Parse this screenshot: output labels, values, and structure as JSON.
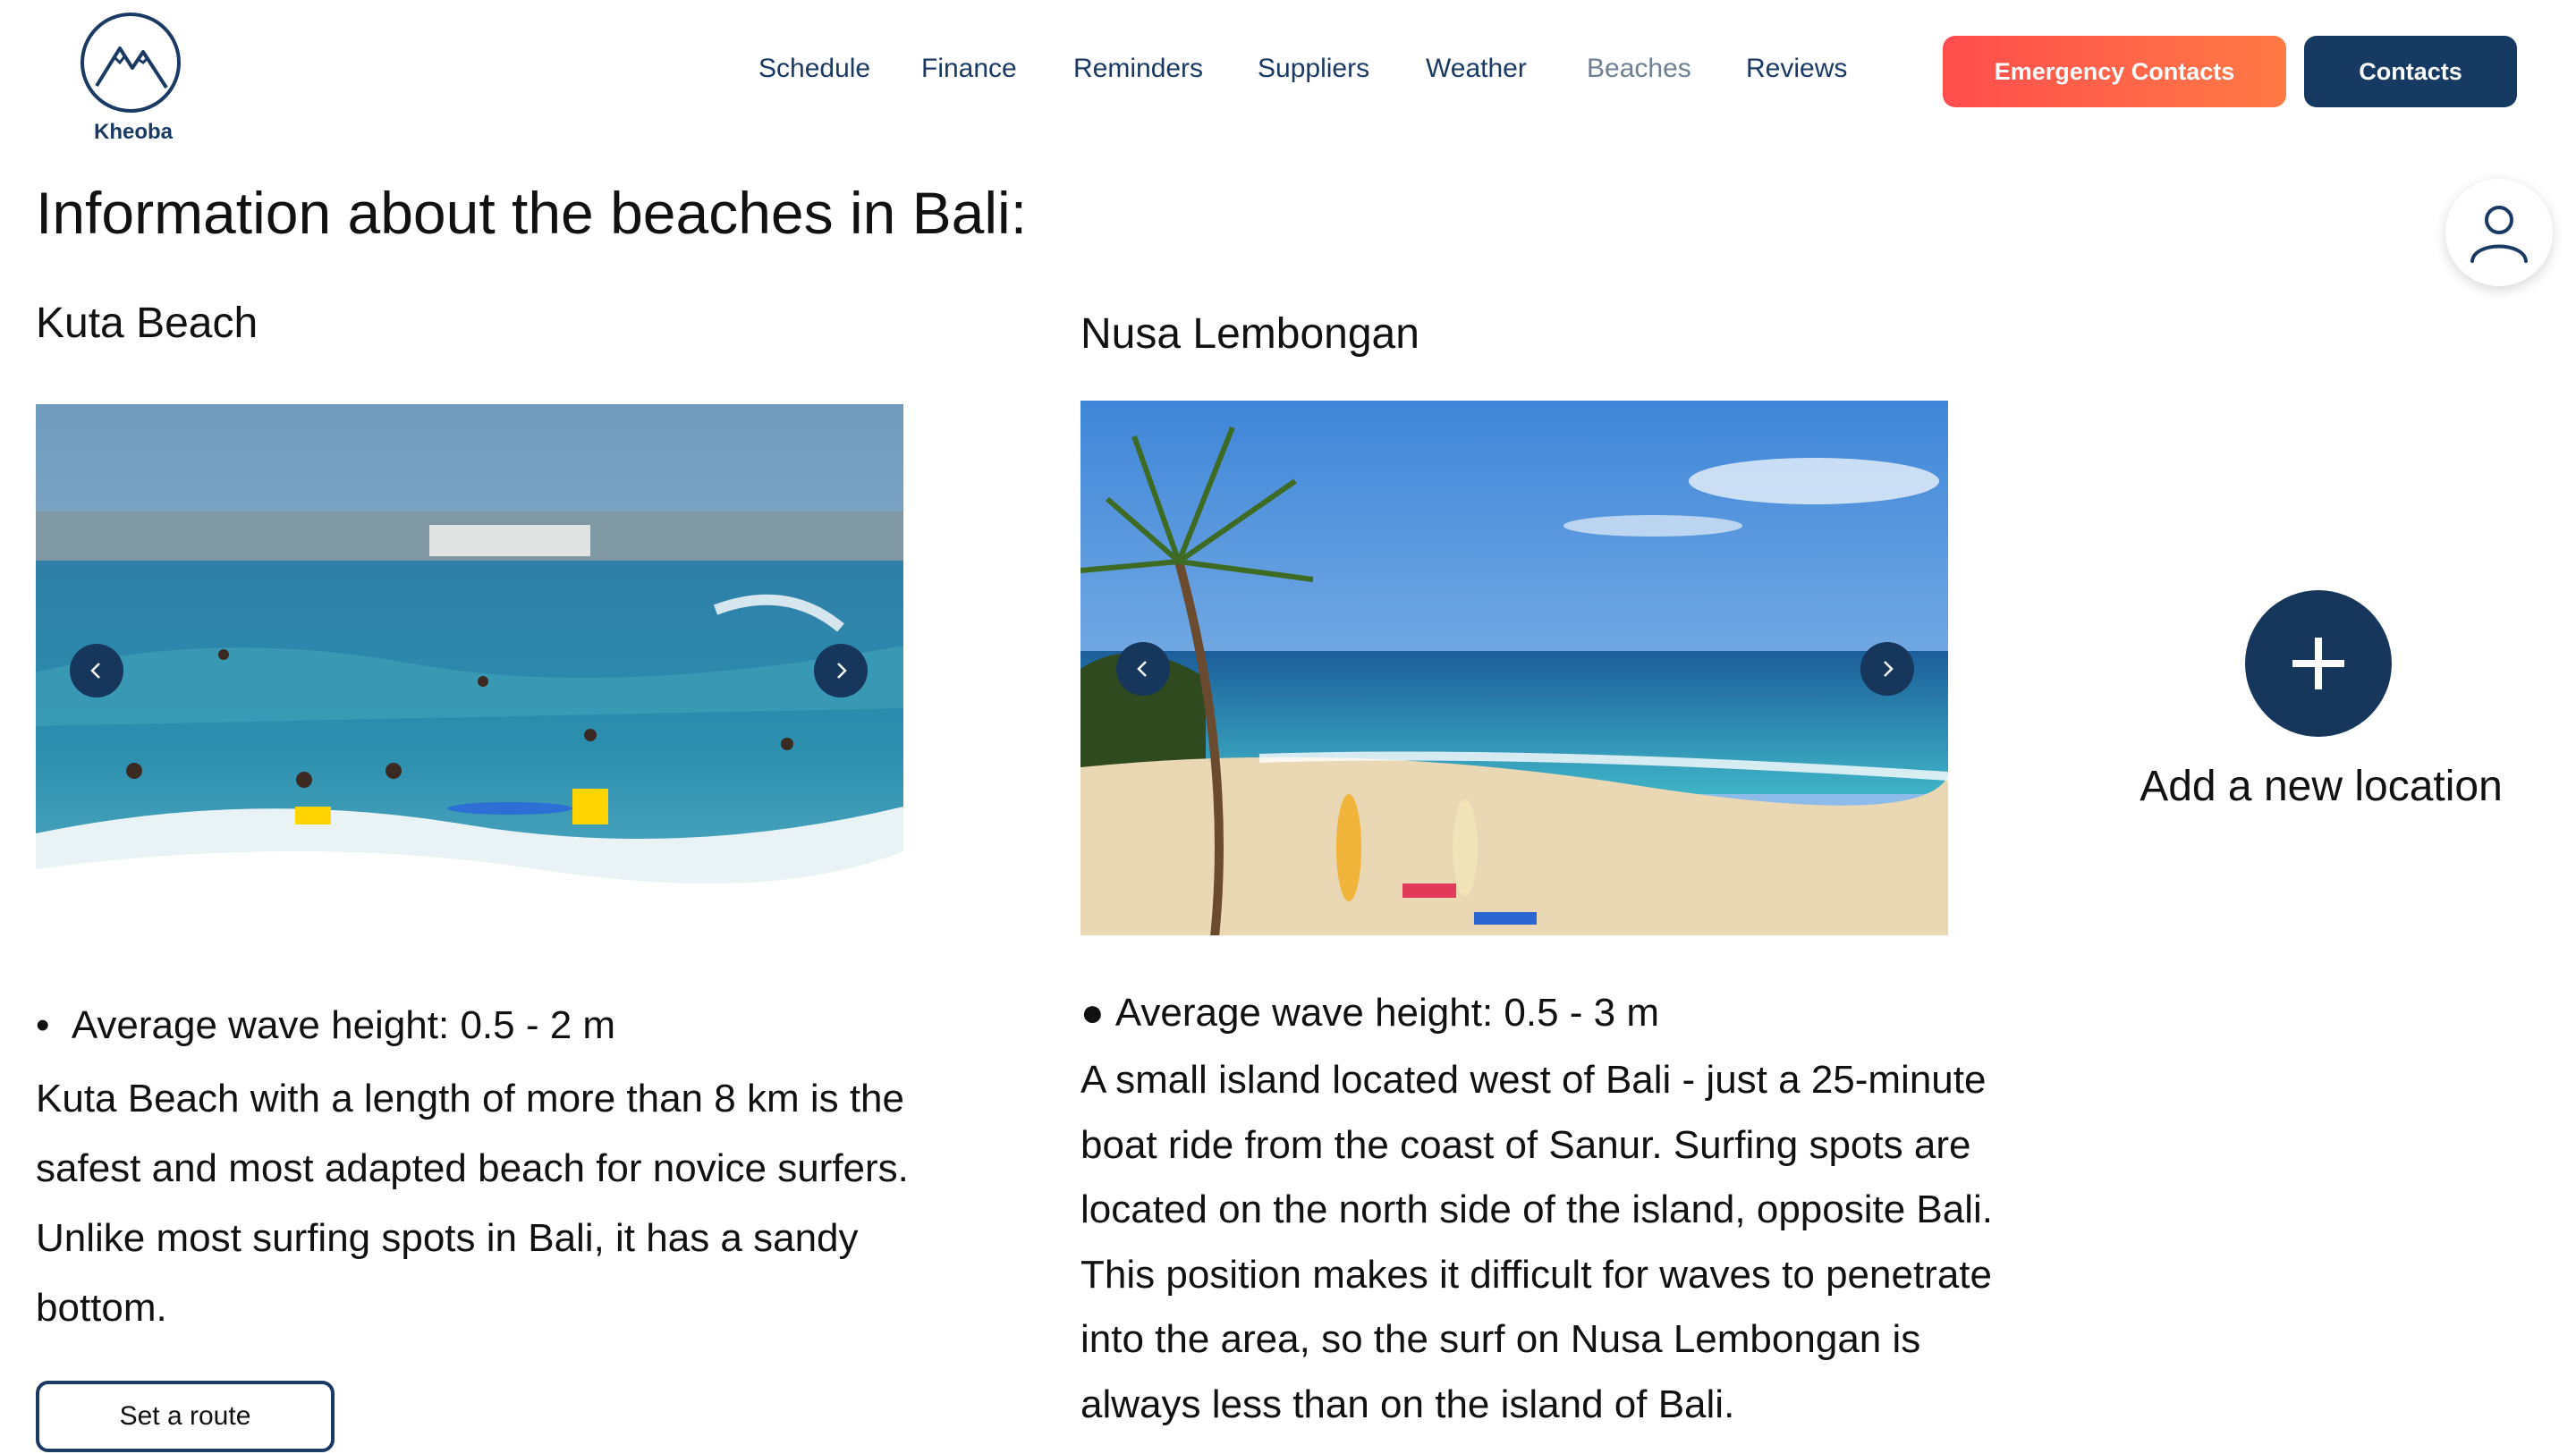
{
  "brand": {
    "name": "Kheoba",
    "color": "#1a3a63"
  },
  "nav": {
    "items": [
      {
        "label": "Schedule"
      },
      {
        "label": "Finance"
      },
      {
        "label": "Reminders"
      },
      {
        "label": "Suppliers"
      },
      {
        "label": "Weather"
      },
      {
        "label": "Beaches",
        "active": true
      },
      {
        "label": "Reviews"
      }
    ]
  },
  "header": {
    "emergency_label": "Emergency Contacts",
    "contacts_label": "Contacts",
    "avatar_icon": "user-icon"
  },
  "page": {
    "title": "Information about the beaches in Bali:"
  },
  "beaches": [
    {
      "name": "Kuta Beach",
      "wave": "Average wave height: 0.5 - 2 m",
      "description": "Kuta Beach with a length of more than 8 km is the safest and most adapted beach for novice surfers. Unlike most surfing spots in Bali, it has a sandy bottom.",
      "button": "Set a route"
    },
    {
      "name": "Nusa Lembongan",
      "wave": "Average wave height: 0.5 - 3 m",
      "description": "A small island located west of Bali - just a 25-minute boat ride from the coast of Sanur. Surfing spots are located on the north side of the island, opposite Bali. This position makes it difficult for waves to penetrate into the area, so the surf on Nusa Lembongan is always less than on the island of Bali."
    }
  ],
  "add_location": {
    "label": "Add a new location",
    "icon": "plus-icon"
  },
  "colors": {
    "primary": "#173a62",
    "emergency_start": "#ff4d4d",
    "emergency_end": "#ff7a45",
    "muted_nav": "#6f7f92"
  }
}
